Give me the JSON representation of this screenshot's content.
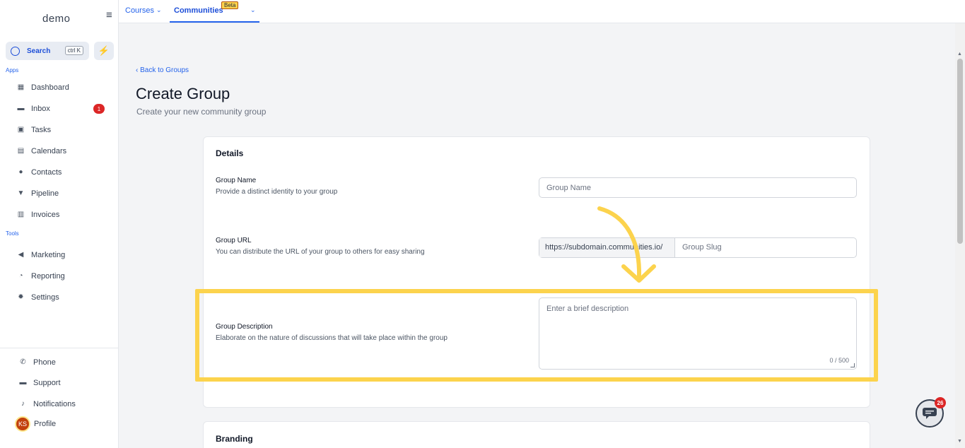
{
  "sidebar": {
    "logo": "demo",
    "collapse_icon": "≡",
    "search_label": "Search",
    "search_shortcut": "ctrl K",
    "apps_label": "Apps",
    "tools_label": "Tools",
    "items": [
      {
        "label": "Dashboard",
        "icon": "dashboard-icon"
      },
      {
        "label": "Inbox",
        "icon": "inbox-icon",
        "badge": "1"
      },
      {
        "label": "Tasks",
        "icon": "tasks-icon"
      },
      {
        "label": "Calendars",
        "icon": "calendar-icon"
      },
      {
        "label": "Contacts",
        "icon": "contacts-icon"
      },
      {
        "label": "Pipeline",
        "icon": "pipeline-icon"
      },
      {
        "label": "Invoices",
        "icon": "invoices-icon"
      }
    ],
    "tools": [
      {
        "label": "Marketing",
        "icon": "megaphone-icon"
      },
      {
        "label": "Reporting",
        "icon": "reporting-icon"
      },
      {
        "label": "Settings",
        "icon": "gear-icon"
      }
    ],
    "bottom": [
      {
        "label": "Phone",
        "icon": "phone-icon"
      },
      {
        "label": "Support",
        "icon": "support-icon"
      },
      {
        "label": "Notifications",
        "icon": "bell-icon"
      },
      {
        "label": "Profile",
        "avatar": "KS"
      }
    ]
  },
  "topbar": {
    "tabs": [
      {
        "label": "Courses"
      },
      {
        "label": "Communities",
        "badge": "Beta"
      }
    ]
  },
  "main": {
    "back_link": "Back to Groups",
    "title": "Create Group",
    "subtitle": "Create your new community group",
    "details_card": {
      "heading": "Details",
      "group_name": {
        "label": "Group Name",
        "help": "Provide a distinct identity to your group",
        "placeholder": "Group Name"
      },
      "group_url": {
        "label": "Group URL",
        "help": "You can distribute the URL of your group to others for easy sharing",
        "prefix": "https://subdomain.communities.io/",
        "placeholder": "Group Slug"
      },
      "group_description": {
        "label": "Group Description",
        "help": "Elaborate on the nature of discussions that will take place within the group",
        "placeholder": "Enter a brief description",
        "counter": "0 / 500"
      }
    },
    "branding_card": {
      "heading": "Branding"
    }
  },
  "chat_widget": {
    "badge": "26"
  },
  "colors": {
    "accent": "#2563eb",
    "highlight": "#fcd34d",
    "arrow": "#fcd34d",
    "badge": "#dc2626"
  }
}
